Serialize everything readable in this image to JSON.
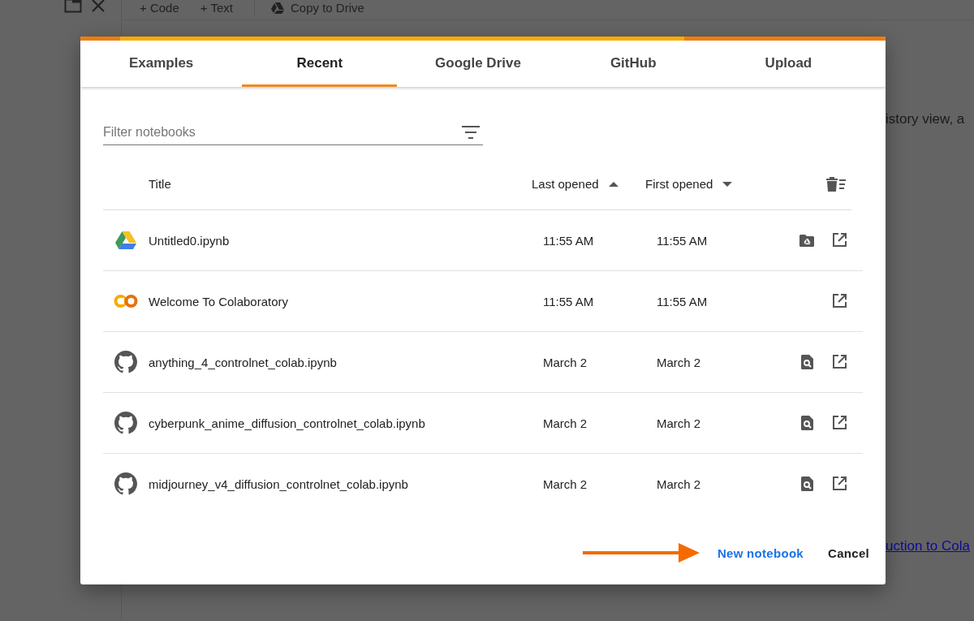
{
  "toolbar": {
    "items": [
      "+ Code",
      "+ Text",
      "Copy to Drive"
    ]
  },
  "background": {
    "text_fragment": "istory view, a",
    "link_fragment": "uction to Cola"
  },
  "dialog": {
    "tabs": [
      {
        "label": "Examples",
        "selected": false
      },
      {
        "label": "Recent",
        "selected": true
      },
      {
        "label": "Google Drive",
        "selected": false
      },
      {
        "label": "GitHub",
        "selected": false
      },
      {
        "label": "Upload",
        "selected": false
      }
    ],
    "progress": {
      "level": 0.25
    },
    "filter": {
      "placeholder": "Filter notebooks"
    },
    "table": {
      "columns": [
        {
          "label": "Title"
        },
        {
          "label": "Last opened",
          "ascending": true
        },
        {
          "label": "First opened",
          "ascending": false
        }
      ],
      "rows": [
        {
          "kind": "drive",
          "title": "Untitled0.ipynb",
          "last_opened": "11:55 AM",
          "first_opened": "11:55 AM",
          "in_drive": true,
          "previewable": false
        },
        {
          "kind": "colab",
          "title": "Welcome To Colaboratory",
          "last_opened": "11:55 AM",
          "first_opened": "11:55 AM",
          "in_drive": false,
          "previewable": false
        },
        {
          "kind": "github",
          "title": "anything_4_controlnet_colab.ipynb",
          "last_opened": "March 2",
          "first_opened": "March 2",
          "in_drive": false,
          "previewable": true
        },
        {
          "kind": "github",
          "title": "cyberpunk_anime_diffusion_controlnet_colab.ipynb",
          "last_opened": "March 2",
          "first_opened": "March 2",
          "in_drive": false,
          "previewable": true
        },
        {
          "kind": "github",
          "title": "midjourney_v4_diffusion_controlnet_colab.ipynb",
          "last_opened": "March 2",
          "first_opened": "March 2",
          "in_drive": false,
          "previewable": true
        }
      ]
    },
    "buttons": [
      "New notebook",
      "Cancel"
    ]
  }
}
